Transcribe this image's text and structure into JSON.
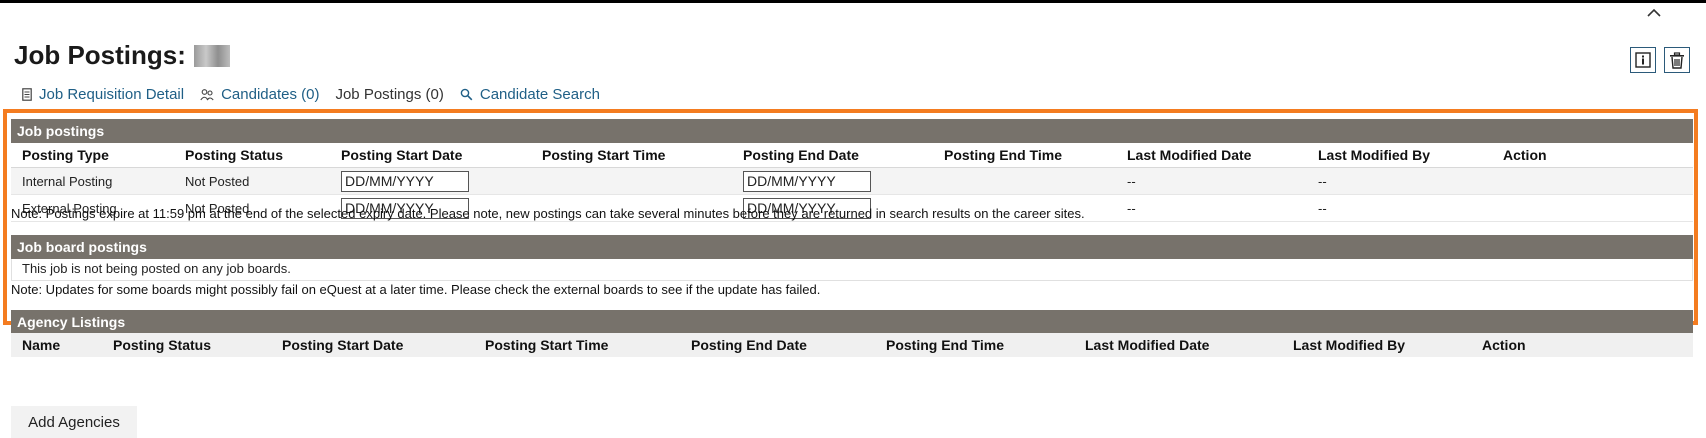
{
  "page": {
    "title": "Job Postings:",
    "tabs": [
      {
        "label": "Job Requisition Detail",
        "icon": "document-icon"
      },
      {
        "label": "Candidates (0)",
        "icon": "people-icon"
      },
      {
        "label": "Job Postings (0)",
        "icon": null,
        "active": true
      },
      {
        "label": "Candidate Search",
        "icon": "search-icon"
      }
    ]
  },
  "job_postings": {
    "header": "Job postings",
    "columns": [
      "Posting Type",
      "Posting Status",
      "Posting Start Date",
      "Posting Start Time",
      "Posting End Date",
      "Posting End Time",
      "Last Modified Date",
      "Last Modified By",
      "Action"
    ],
    "rows": [
      {
        "type": "Internal Posting",
        "status": "Not Posted",
        "start_date": "DD/MM/YYYY",
        "end_date": "DD/MM/YYYY",
        "modified_date": "--",
        "modified_by": "--"
      },
      {
        "type": "External Posting",
        "status": "Not Posted",
        "start_date": "DD/MM/YYYY",
        "end_date": "DD/MM/YYYY",
        "modified_date": "--",
        "modified_by": "--"
      }
    ],
    "note": "Note: Postings expire at 11:59 pm at the end of the selected expiry date. Please note, new postings can take several minutes before they are returned in search results on the career sites."
  },
  "job_board": {
    "header": "Job board postings",
    "message": "This job is not being posted on any job boards.",
    "note": "Note: Updates for some boards might possibly fail on eQuest at a later time. Please check the external boards to see if the update has failed."
  },
  "agency": {
    "header": "Agency Listings",
    "columns": [
      "Name",
      "Posting Status",
      "Posting Start Date",
      "Posting Start Time",
      "Posting End Date",
      "Posting End Time",
      "Last Modified Date",
      "Last Modified By",
      "Action"
    ],
    "add_button": "Add Agencies"
  },
  "colors": {
    "highlight": "#f47c20",
    "header_bg": "#77726b",
    "link": "#1f5f86"
  }
}
